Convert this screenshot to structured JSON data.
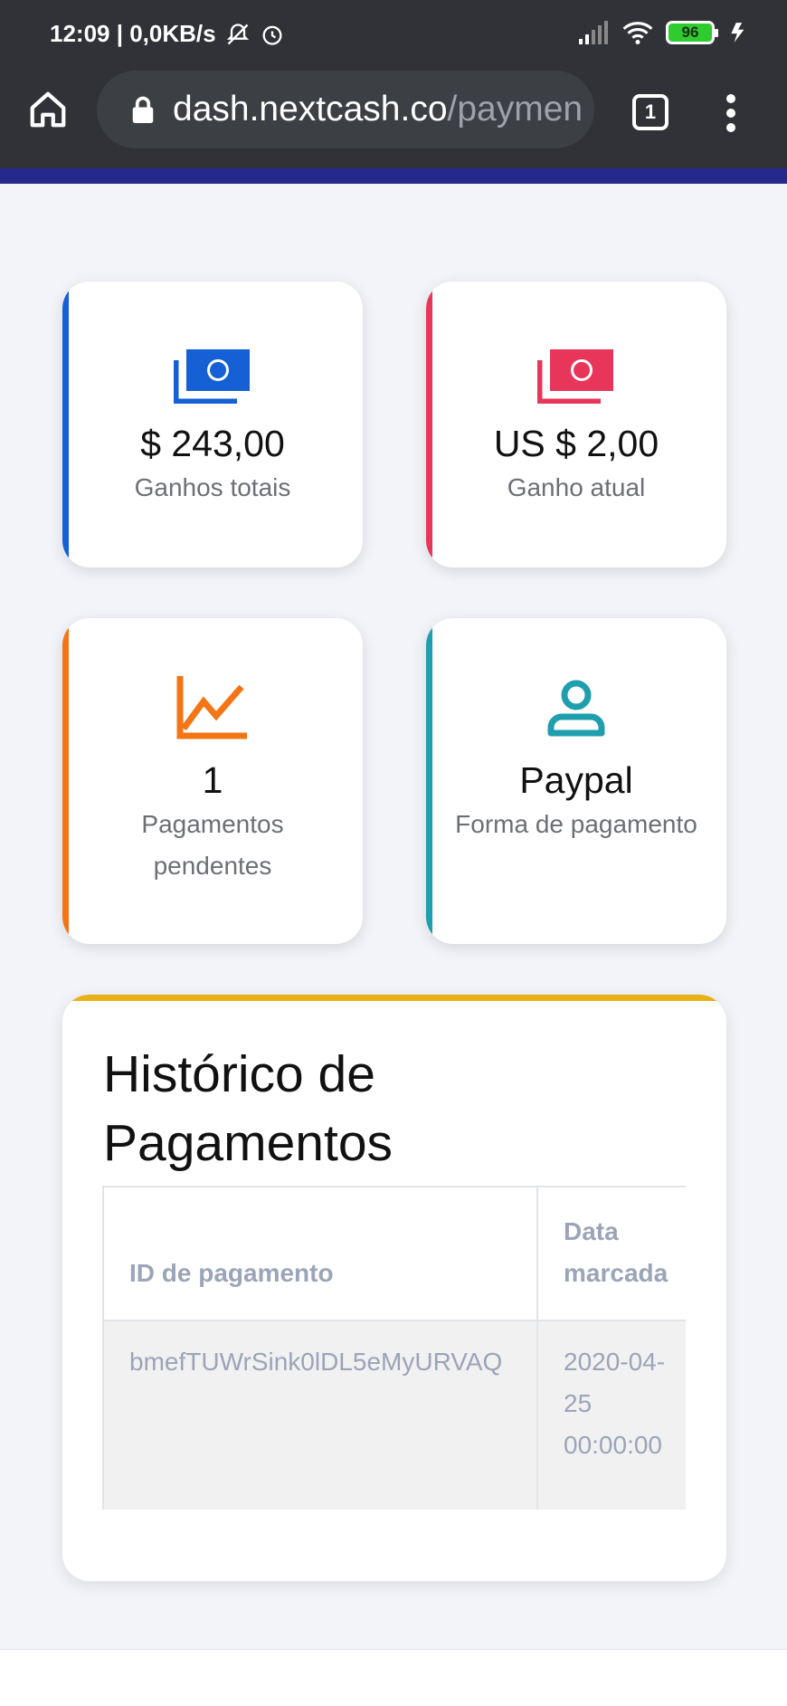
{
  "status": {
    "time_info": "12:09 | 0,0KB/s",
    "battery": "96"
  },
  "browser": {
    "url_host": "dash.nextcash.co",
    "url_path": "/paymen",
    "tab_count": "1"
  },
  "stats": [
    {
      "value": "$ 243,00",
      "label": "Ganhos totais",
      "icon": "money-icon",
      "color": "#1460d4"
    },
    {
      "value": "US $ 2,00",
      "label": "Ganho atual",
      "icon": "money-icon",
      "color": "#e8365b"
    },
    {
      "value": "1",
      "label": "Pagamentos pendentes",
      "icon": "chart-line-icon",
      "color": "#f47516"
    },
    {
      "value": "Paypal",
      "label": "Forma de pagamento",
      "icon": "user-icon",
      "color": "#1f9eae"
    }
  ],
  "history": {
    "title": "Histórico de Pagamentos",
    "columns": [
      "ID de pagamento",
      "Data marcada"
    ],
    "rows": [
      [
        "bmefTUWrSink0lDL5eMyURVAQ",
        "2020-04-25 00:00:00"
      ]
    ],
    "accent": "#e8b117"
  }
}
